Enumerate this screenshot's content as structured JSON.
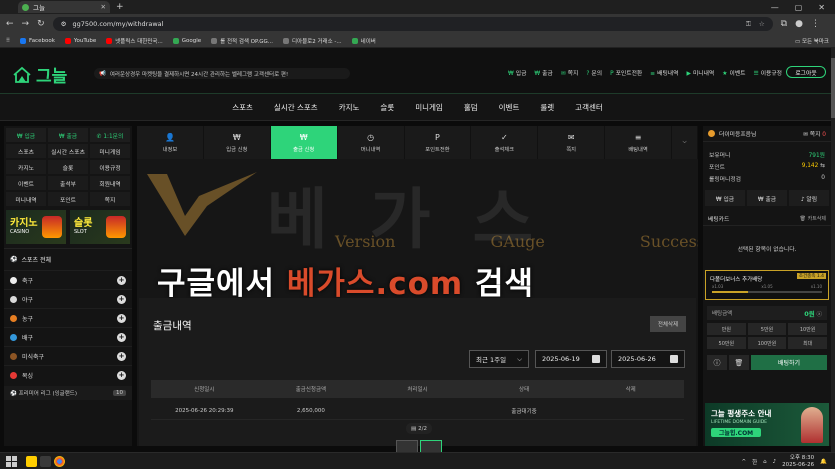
{
  "browser": {
    "tab_title": "그늘",
    "url": "gg7500.com/my/withdrawal",
    "bookmarks": [
      {
        "label": "Facebook",
        "cls": ""
      },
      {
        "label": "YouTube",
        "cls": "red"
      },
      {
        "label": "넷플릭스 대한민국...",
        "cls": "red"
      },
      {
        "label": "Google",
        "cls": "grn"
      },
      {
        "label": "롤 전적 검색 OP.GG...",
        "cls": "gry"
      },
      {
        "label": "디아블로2 거래소 -...",
        "cls": "gry"
      },
      {
        "label": "네이버",
        "cls": "grn"
      }
    ],
    "all_bookmarks": "모든 북마크"
  },
  "header": {
    "logo_text": "그늘",
    "notice": "여러운상경우 마켓팅을 결제하시면 24시간 관리하는 벨레그램 고객센터로 편!",
    "menu": [
      {
        "icon": "₩",
        "label": "입금"
      },
      {
        "icon": "₩",
        "label": "출금"
      },
      {
        "icon": "✉",
        "label": "쪽지"
      },
      {
        "icon": "?",
        "label": "문의"
      },
      {
        "icon": "P",
        "label": "포인트전환"
      },
      {
        "icon": "≡",
        "label": "배팅내역"
      },
      {
        "icon": "▶",
        "label": "미니내역"
      },
      {
        "icon": "★",
        "label": "이벤트"
      },
      {
        "icon": "☰",
        "label": "이용규정"
      }
    ],
    "logout": "로그아웃"
  },
  "nav": [
    "스포츠",
    "실시간 스포츠",
    "카지노",
    "슬롯",
    "미니게임",
    "홀덤",
    "이벤트",
    "룰렛",
    "고객센터"
  ],
  "left": {
    "top": [
      "₩ 입금",
      "₩ 출금",
      "✆ 1:1문의"
    ],
    "grid": [
      "스포츠",
      "실시간 스포츠",
      "미니게임",
      "카지노",
      "슬롯",
      "이용규정",
      "이벤트",
      "출석부",
      "회원내역",
      "미니내역",
      "포인트",
      "쪽지"
    ],
    "banners": [
      {
        "title": "카지노",
        "sub": "CASINO"
      },
      {
        "title": "슬롯",
        "sub": "SLOT"
      }
    ],
    "sports_title": "스포츠 전체",
    "sports": [
      {
        "label": "축구",
        "color": "#eeeeee"
      },
      {
        "label": "야구",
        "color": "#d9d9d9"
      },
      {
        "label": "농구",
        "color": "#e67e22"
      },
      {
        "label": "배구",
        "color": "#3498db"
      },
      {
        "label": "미식축구",
        "color": "#8d5524"
      },
      {
        "label": "복싱",
        "color": "#e53935"
      }
    ],
    "league": "프리미어 리그 (잉글랜드)",
    "league_count": "10"
  },
  "center": {
    "tabs": [
      {
        "icon": "👤",
        "label": "내정보"
      },
      {
        "icon": "₩",
        "label": "입금 신청"
      },
      {
        "icon": "₩",
        "label": "출금 신청"
      },
      {
        "icon": "◷",
        "label": "머니내역"
      },
      {
        "icon": "P",
        "label": "포인트전환"
      },
      {
        "icon": "✓",
        "label": "출석체크"
      },
      {
        "icon": "✉",
        "label": "쪽지"
      },
      {
        "icon": "≡",
        "label": "배팅내역"
      }
    ],
    "watermark": {
      "letters": "베가스",
      "words": [
        "Version",
        "GAuge",
        "Success"
      ],
      "slogan_pre": "구글에서 ",
      "slogan_brand": "베가스.com",
      "slogan_post": " 검색"
    },
    "title": "출금내역",
    "refresh": "전체삭제",
    "period": "최근 1주일",
    "date_from": "2025-06-19",
    "date_to": "2025-06-26",
    "columns": [
      "신청일시",
      "출금신청금액",
      "처리일시",
      "상태",
      "삭제"
    ],
    "rows": [
      [
        "2025-06-26 20:29:39",
        "2,650,000",
        "",
        "출금대기중",
        ""
      ]
    ],
    "pager": "2/2"
  },
  "right": {
    "username": "더이미응프음님",
    "msg_label": "쪽지",
    "msg_count": "0",
    "balance_label": "보유머니",
    "balance": "791원",
    "point_label": "포인트",
    "point": "9,142",
    "casino_label": "롤링머니정검",
    "casino": "0",
    "btns": [
      "₩ 입금",
      "₩ 출금",
      "♪ 알림"
    ],
    "slip_title": "베팅카드",
    "slip_right": "카트삭제",
    "slip_empty": "선택된 항목이 없습니다.",
    "combo_title": "다폴더보너스 추가배당",
    "combo_badge": "조건충족 1.4",
    "combo_levels": [
      "x1.03",
      "x1.05",
      "x1.10"
    ],
    "bet_label": "배팅금액",
    "bet_value": "0원",
    "quick": [
      "만원",
      "5만원",
      "10만원",
      "50만원",
      "100만원",
      "최대"
    ],
    "bet_button": "배팅하기",
    "promo_title": "그늘 평생주소 안내",
    "promo_sub": "LIFETIME DOMAIN GUIDE",
    "promo_domain": "그늘힙.COM"
  },
  "taskbar": {
    "lang": "한",
    "time": "오후 8:30",
    "date": "2025-06-26"
  }
}
